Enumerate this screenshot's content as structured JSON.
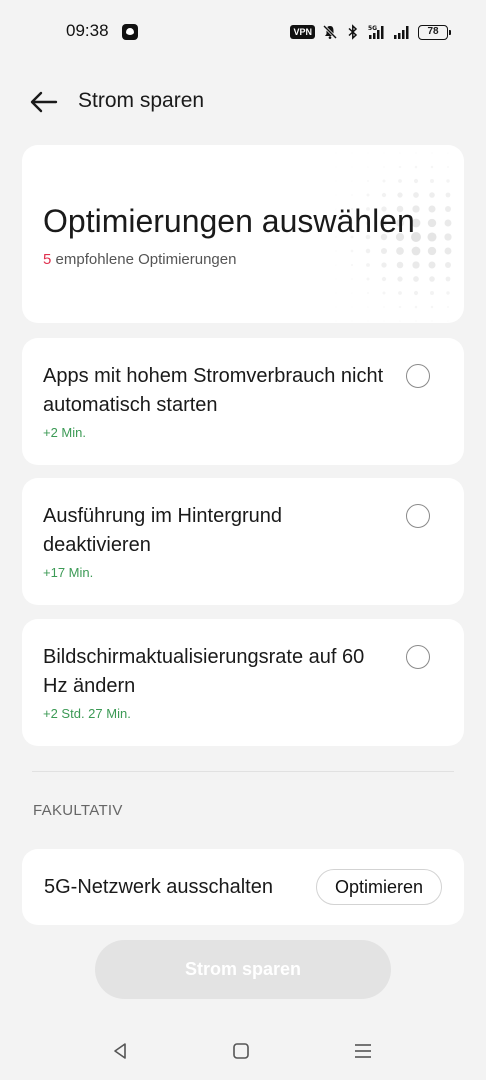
{
  "status_bar": {
    "time": "09:38",
    "vpn": "VPN",
    "network": "5G",
    "battery": "78"
  },
  "header": {
    "title": "Strom sparen"
  },
  "hero": {
    "title": "Optimierungen auswählen",
    "count": "5",
    "subtitle": "empfohlene Optimierungen",
    "accent_color": "#e0304e"
  },
  "optimizations": [
    {
      "title": "Apps mit hohem Stromverbrauch nicht automatisch starten",
      "gain": "+2 Min.",
      "selected": false
    },
    {
      "title": "Ausführung im Hintergrund deaktivieren",
      "gain": "+17 Min.",
      "selected": false
    },
    {
      "title": "Bildschirmaktualisierungsrate auf 60 Hz ändern",
      "gain": "+2 Std. 27 Min.",
      "selected": false
    }
  ],
  "optional": {
    "section_label": "FAKULTATIV",
    "item_label": "5G-Netzwerk ausschalten",
    "button_label": "Optimieren"
  },
  "footer": {
    "save_button": "Strom sparen"
  },
  "colors": {
    "gain_green": "#3c9a55",
    "background": "#f3f3f3"
  }
}
